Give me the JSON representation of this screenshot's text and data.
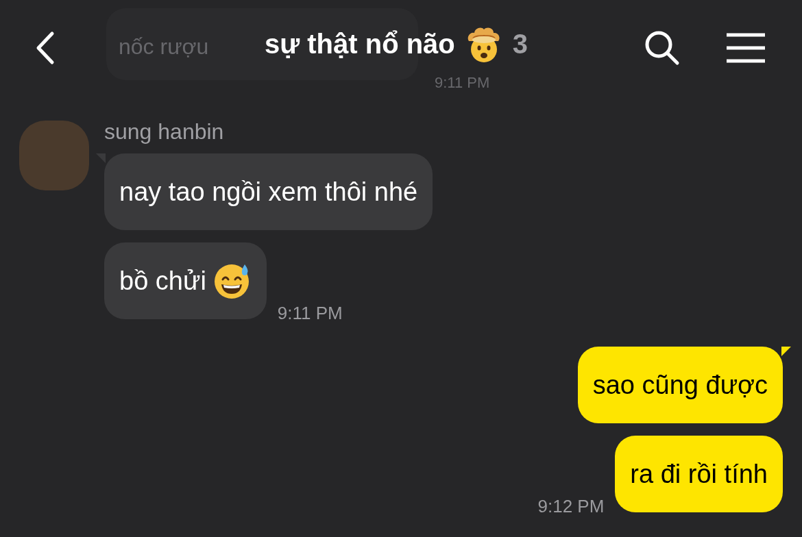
{
  "header": {
    "title": "sự thật nổ não",
    "title_has_emoji": true,
    "member_count": "3",
    "behind_message": {
      "text": "nốc rượu",
      "time": "9:11 PM"
    }
  },
  "messages": [
    {
      "kind": "incoming",
      "sender": "sung hanbin",
      "text": "nay tao ngồi xem thôi nhé",
      "has_emoji": false,
      "tail": true
    },
    {
      "kind": "incoming",
      "text": "bồ chửi",
      "has_emoji": true,
      "tail": false,
      "time": "9:11 PM"
    },
    {
      "kind": "outgoing",
      "text": "sao cũng được",
      "has_emoji": false,
      "tail": true
    },
    {
      "kind": "outgoing",
      "text": "ra đi rồi tính",
      "has_emoji": false,
      "tail": false,
      "time": "9:12 PM"
    }
  ]
}
